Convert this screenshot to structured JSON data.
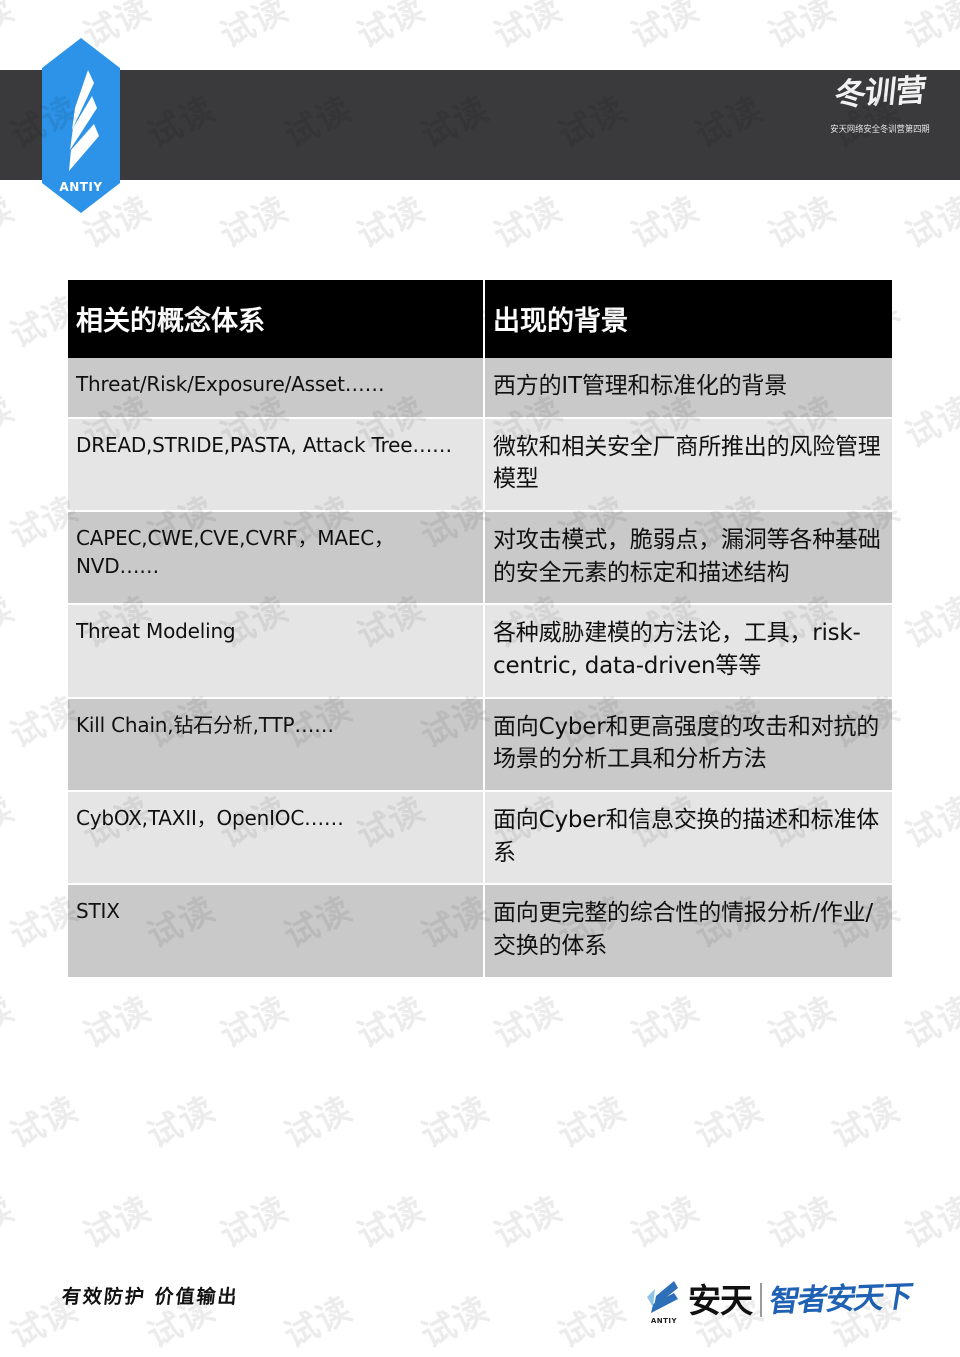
{
  "slide": {
    "background_color": "#ffffff",
    "header_band_color": "#3a3a3c",
    "accent_color": "#2d93e8",
    "table_header_color": "#000000",
    "row_shade_dark": "#c9c9c9",
    "row_shade_light": "#e5e5e5",
    "slogan_color": "#1f62b4"
  },
  "watermark": {
    "text": "试读",
    "repeat_rows": 14,
    "repeat_cols": 8
  },
  "header": {
    "logo_wordmark": "ANTIY",
    "course_mark_calligraphy": "冬训营",
    "course_mark_subtitle": "安天网络安全冬训营第四期"
  },
  "table": {
    "columns": [
      {
        "key": "term",
        "label": "相关的概念体系"
      },
      {
        "key": "context",
        "label": "出现的背景"
      }
    ],
    "rows": [
      {
        "term": "Threat/Risk/Exposure/Asset……",
        "context": "西方的IT管理和标准化的背景"
      },
      {
        "term": "DREAD,STRIDE,PASTA, Attack Tree……",
        "context": "微软和相关安全厂商所推出的风险管理模型"
      },
      {
        "term": "CAPEC,CWE,CVE,CVRF，MAEC，NVD……",
        "context": "对攻击模式，脆弱点，漏洞等各种基础的安全元素的标定和描述结构"
      },
      {
        "term": "Threat Modeling",
        "context": "各种威胁建模的方法论，工具，risk-centric, data-driven等等"
      },
      {
        "term": "Kill Chain,钻石分析,TTP……",
        "context": "面向Cyber和更高强度的攻击和对抗的场景的分析工具和分析方法"
      },
      {
        "term": "CybOX,TAXII，OpenIOC……",
        "context": "面向Cyber和信息交换的描述和标准体系"
      },
      {
        "term": "STIX",
        "context": "面向更完整的综合性的情报分析/作业/交换的体系"
      }
    ]
  },
  "footer": {
    "tagline": "有效防护 价值输出",
    "logo_wordmark": "ANTIY",
    "logo_cn": "安天",
    "logo_slogan": "智者安天下"
  }
}
